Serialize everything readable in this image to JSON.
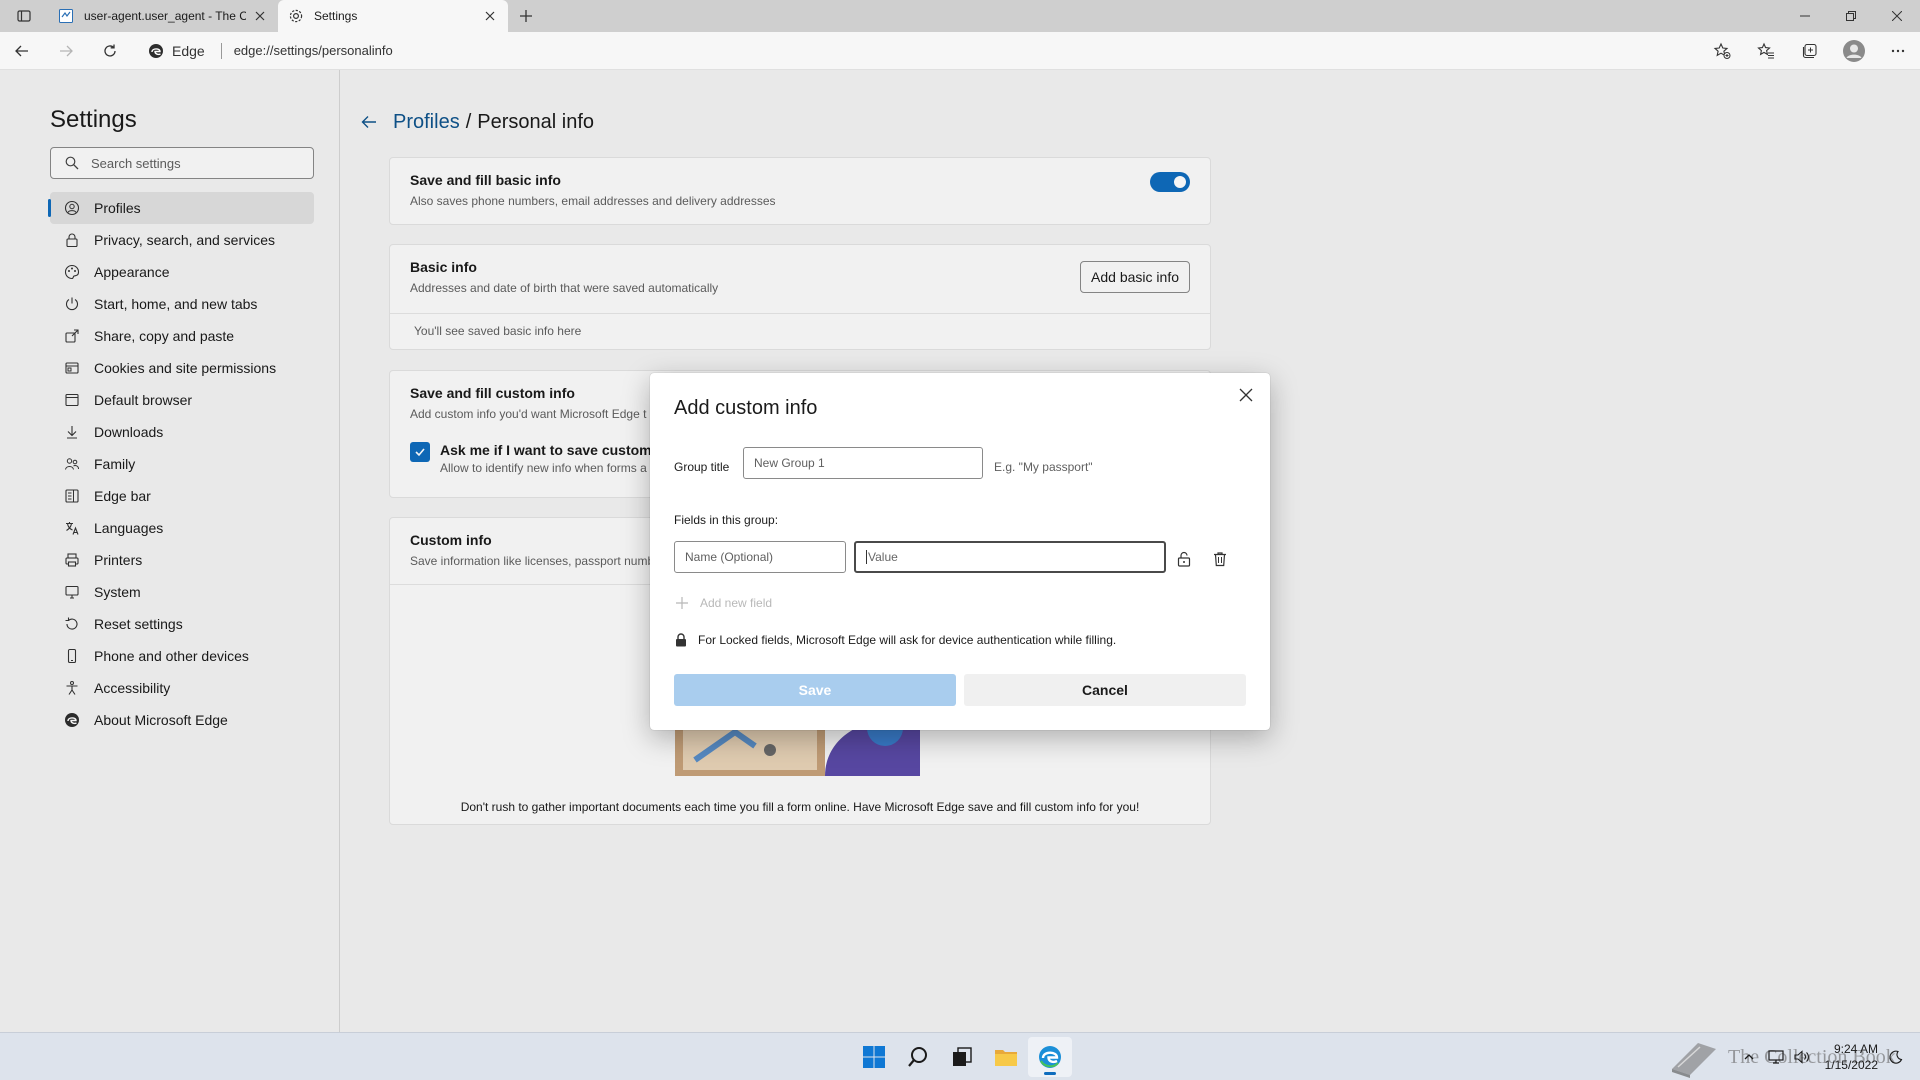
{
  "browser": {
    "tabs": [
      {
        "title": "user-agent.user_agent - The Coll",
        "active": false
      },
      {
        "title": "Settings",
        "active": true
      }
    ],
    "site_label": "Edge",
    "url": "edge://settings/personalinfo"
  },
  "sidebar": {
    "title": "Settings",
    "search_placeholder": "Search settings",
    "items": [
      {
        "label": "Profiles",
        "icon": "profile-icon"
      },
      {
        "label": "Privacy, search, and services",
        "icon": "lock-icon"
      },
      {
        "label": "Appearance",
        "icon": "palette-icon"
      },
      {
        "label": "Start, home, and new tabs",
        "icon": "power-icon"
      },
      {
        "label": "Share, copy and paste",
        "icon": "share-icon"
      },
      {
        "label": "Cookies and site permissions",
        "icon": "cookie-icon"
      },
      {
        "label": "Default browser",
        "icon": "browser-icon"
      },
      {
        "label": "Downloads",
        "icon": "download-icon"
      },
      {
        "label": "Family",
        "icon": "family-icon"
      },
      {
        "label": "Edge bar",
        "icon": "edge-bar-icon"
      },
      {
        "label": "Languages",
        "icon": "languages-icon"
      },
      {
        "label": "Printers",
        "icon": "printer-icon"
      },
      {
        "label": "System",
        "icon": "system-icon"
      },
      {
        "label": "Reset settings",
        "icon": "reset-icon"
      },
      {
        "label": "Phone and other devices",
        "icon": "phone-icon"
      },
      {
        "label": "Accessibility",
        "icon": "accessibility-icon"
      },
      {
        "label": "About Microsoft Edge",
        "icon": "edge-logo-icon"
      }
    ]
  },
  "main": {
    "breadcrumb_link": "Profiles",
    "breadcrumb_sep": "/",
    "breadcrumb_current": "Personal info",
    "save_fill_basic": {
      "title": "Save and fill basic info",
      "desc": "Also saves phone numbers, email addresses and delivery addresses",
      "toggle_on": true
    },
    "basic_info": {
      "title": "Basic info",
      "desc": "Addresses and date of birth that were saved automatically",
      "button": "Add basic info",
      "empty": "You'll see saved basic info here"
    },
    "save_fill_custom": {
      "title": "Save and fill custom info",
      "desc": "Add custom info you'd want Microsoft Edge t",
      "checkbox_label": "Ask me if I want to save custom i",
      "checkbox_desc": "Allow to identify new info when forms a"
    },
    "custom_info": {
      "title": "Custom info",
      "desc": "Save information like licenses, passport numb",
      "footer": "Don't rush to gather important documents each time you fill a form online. Have Microsoft Edge save and fill custom info for you!"
    }
  },
  "dialog": {
    "title": "Add custom info",
    "group_title_label": "Group title",
    "group_title_placeholder": "New Group 1",
    "group_title_hint": "E.g. \"My passport\"",
    "fields_label": "Fields in this group:",
    "name_placeholder": "Name (Optional)",
    "value_placeholder": "Value",
    "add_new_field": "Add new field",
    "note": "For Locked fields, Microsoft Edge will ask for device authentication while filling.",
    "save_label": "Save",
    "cancel_label": "Cancel"
  },
  "taskbar": {
    "time": "9:24 AM",
    "date": "1/15/2022",
    "watermark": "The Collection Book"
  },
  "colors": {
    "accent": "#0f6cbd",
    "link": "#0f548c",
    "save_disabled": "#a9cdee"
  }
}
